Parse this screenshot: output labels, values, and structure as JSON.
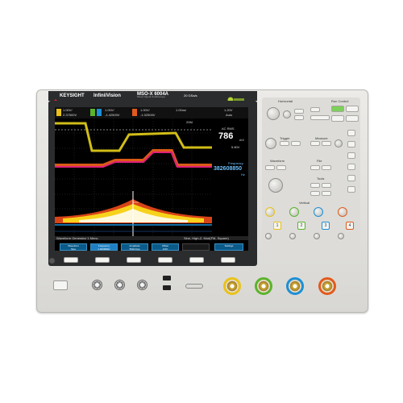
{
  "brand": {
    "name": "KEYSIGHT",
    "series": "InfiniiVision",
    "model": "MSO-X 6004A",
    "model_sub": "Mixed Signal Oscilloscope",
    "spec": "20 GSa/s"
  },
  "screen": {
    "ch_readouts": [
      {
        "scale": "1.00V/",
        "offset": "2.37500V"
      },
      {
        "scale": "1.00V/",
        "offset": "-1.42500V"
      },
      {
        "scale": "1.00V/",
        "offset": "-1.02500V"
      }
    ],
    "time_scale": "1.00ns/",
    "trigger_level": "1.20V",
    "trigger_mode": "Auto",
    "acq_label": "20M",
    "ac_rms_label": "AC RMS",
    "ac_rms_value": "786",
    "ac_rms_unit": "mV",
    "meas_secondary": "5.80V",
    "freq_label": "Frequency",
    "freq_value": "382608850",
    "freq_unit": "Hz",
    "status_left": "Waveform Generator 1 Menu",
    "status_right": "Sine, High-Z, Mod(FM, Square)",
    "softkeys": [
      {
        "title": "Waveform",
        "value": "Sine"
      },
      {
        "title": "Frequency",
        "value": "1.0230MHz"
      },
      {
        "title": "Amplitude",
        "value": "500mVpp"
      },
      {
        "title": "Offset",
        "value": "0.0V"
      },
      {
        "title": "",
        "value": ""
      },
      {
        "title": "Settings",
        "value": ""
      }
    ]
  },
  "panel": {
    "horizontal_label": "Horizontal",
    "run_control_label": "Run Control",
    "trigger_label": "Trigger",
    "measure_label": "Measure",
    "waveform_label": "Waveform",
    "file_label": "File",
    "tools_label": "Tools",
    "vertical_label": "Vertical",
    "single_label": "Single",
    "run_stop_label": "Run/Stop",
    "default_label": "Default"
  },
  "channels": [
    {
      "num": "1",
      "color": "#e8c21a"
    },
    {
      "num": "2",
      "color": "#5bb32d"
    },
    {
      "num": "3",
      "color": "#1c8fd6"
    },
    {
      "num": "4",
      "color": "#e25a1d"
    }
  ]
}
